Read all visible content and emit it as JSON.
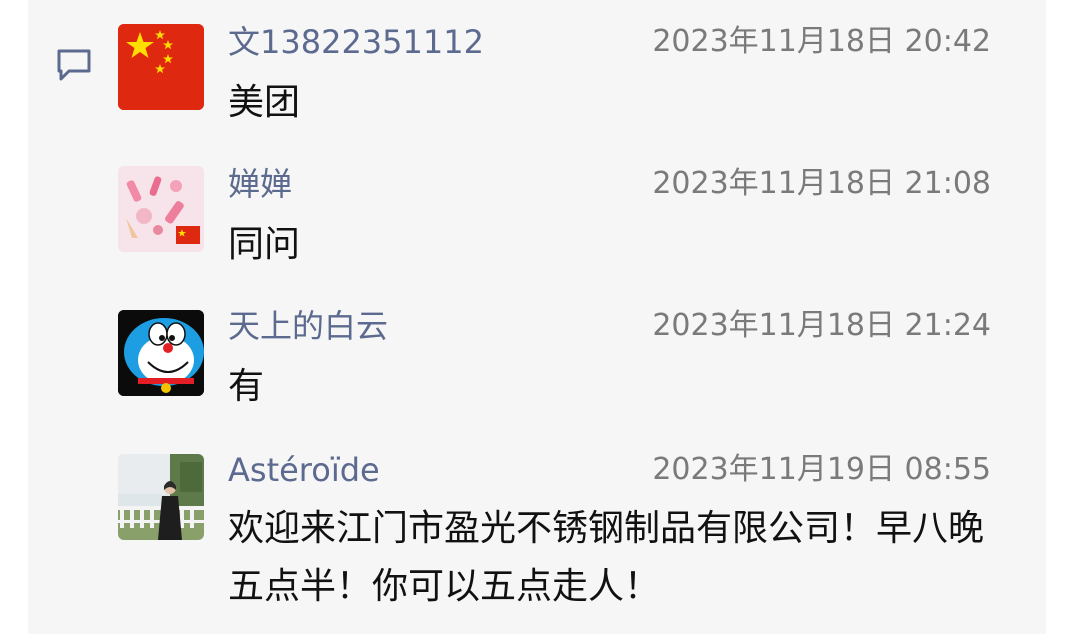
{
  "colors": {
    "name": "#5b6a8e",
    "time": "#7a7a7a",
    "text": "#111111",
    "background": "#f6f6f6"
  },
  "comments": [
    {
      "avatar": "china-flag-avatar",
      "name": "文13822351112",
      "time": "2023年11月18日 20:42",
      "text": "美团"
    },
    {
      "avatar": "pink-cosmetics-avatar",
      "name": "婵婵",
      "time": "2023年11月18日 21:08",
      "text": "同问"
    },
    {
      "avatar": "doraemon-avatar",
      "name": "天上的白云",
      "time": "2023年11月18日 21:24",
      "text": "有"
    },
    {
      "avatar": "photo-avatar",
      "name": "Astéroïde",
      "time": "2023年11月19日 08:55",
      "text": "欢迎来江门市盈光不锈钢制品有限公司！早八晚五点半！你可以五点走人！"
    }
  ]
}
